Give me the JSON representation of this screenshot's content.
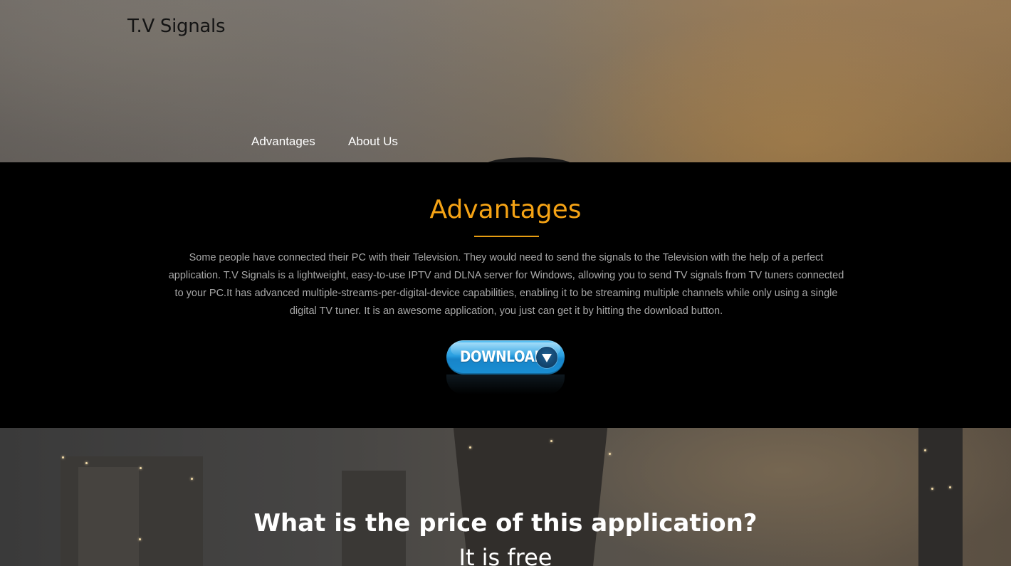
{
  "header": {
    "logo": "T.V Signals",
    "nav": [
      {
        "label": "Advantages"
      },
      {
        "label": "About Us"
      }
    ]
  },
  "advantages": {
    "title": "Advantages",
    "body": "Some people have connected their PC with their Television. They would need to send the signals to the Television with the help of a perfect application. T.V Signals is a lightweight, easy-to-use IPTV and DLNA server for Windows, allowing you to send TV signals from TV tuners connected to your PC.It has advanced multiple-streams-per-digital-device capabilities, enabling it to be streaming multiple channels while only using a single digital TV tuner. It is an awesome application, you just can get it by hitting the download button.",
    "download_label": "DOWNLOAD"
  },
  "price": {
    "title": "What is the price of this application?",
    "subtitle": "It is free"
  },
  "colors": {
    "accent": "#f5a315",
    "download_blue": "#2a9fe0",
    "section_bg": "#000000"
  }
}
